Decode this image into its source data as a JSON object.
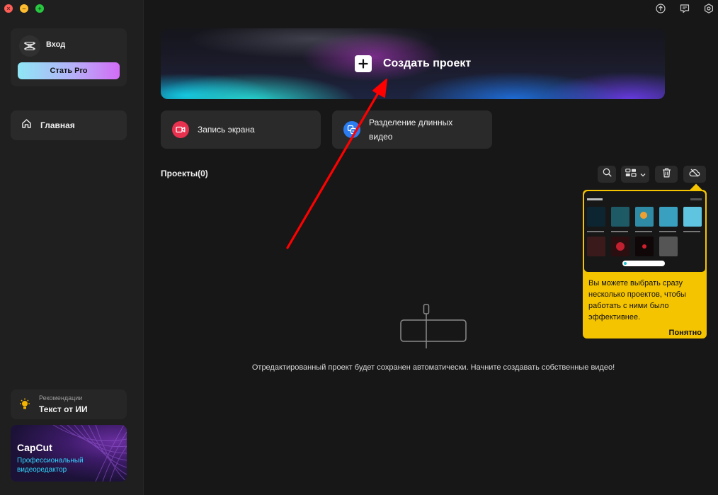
{
  "window": {
    "controls": [
      "close",
      "minimize",
      "maximize"
    ]
  },
  "sidebar": {
    "login_label": "Вход",
    "pro_button": "Стать Pro",
    "nav_home": "Главная",
    "reco_small": "Рекомендации",
    "reco_title": "Текст от ИИ",
    "promo_title": "CapCut",
    "promo_subtitle": "Профессиональный видеоредактор"
  },
  "header_icons": [
    "upload-icon",
    "feedback-icon",
    "settings-icon"
  ],
  "create": {
    "label": "Создать проект"
  },
  "tools": {
    "screen_record": "Запись экрана",
    "split_video": "Разделение длинных видео"
  },
  "projects": {
    "title": "Проекты",
    "count": "(0)"
  },
  "empty_state": {
    "text": "Отредактированный проект будет сохранен автоматически. Начните создавать собственные видео!"
  },
  "tooltip": {
    "text": "Вы можете выбрать сразу несколько проектов, чтобы работать с ними было эффективнее.",
    "ok": "Понятно"
  },
  "colors": {
    "accent_yellow": "#f5c400",
    "annotation_red": "#ff0000",
    "record_red": "#e8304f",
    "split_blue": "#2a7cf0"
  }
}
